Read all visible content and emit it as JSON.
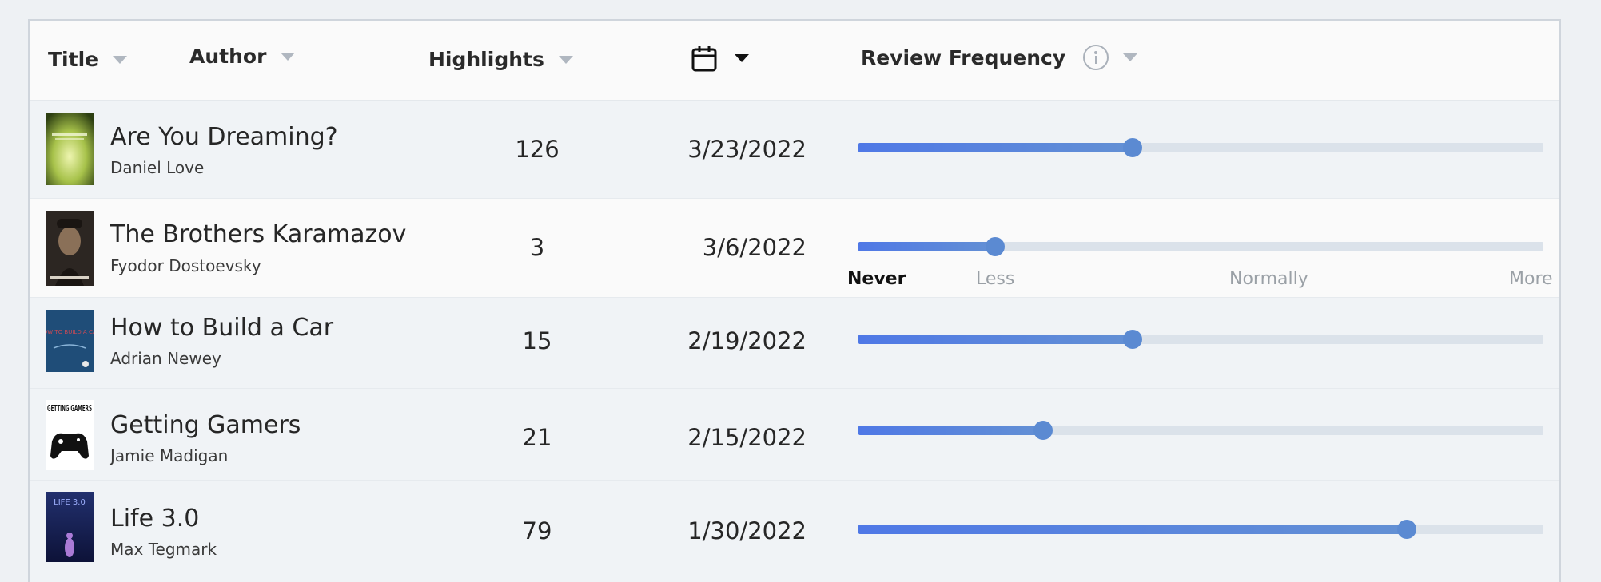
{
  "header": {
    "title_label": "Title",
    "author_label": "Author",
    "highlights_label": "Highlights",
    "review_frequency_label": "Review Frequency"
  },
  "books": [
    {
      "title": "Are You Dreaming?",
      "author": "Daniel Love",
      "highlights": "126",
      "date": "3/23/2022",
      "frequency": 0.4
    },
    {
      "title": "The Brothers Karamazov",
      "author": "Fyodor Dostoevsky",
      "highlights": "3",
      "date": "3/6/2022",
      "frequency": 0.2
    },
    {
      "title": "How to Build a Car",
      "author": "Adrian Newey",
      "highlights": "15",
      "date": "2/19/2022",
      "frequency": 0.4
    },
    {
      "title": "Getting Gamers",
      "author": "Jamie Madigan",
      "highlights": "21",
      "date": "2/15/2022",
      "frequency": 0.27
    },
    {
      "title": "Life 3.0",
      "author": "Max Tegmark",
      "highlights": "79",
      "date": "1/30/2022",
      "frequency": 0.8
    }
  ],
  "frequency_scale": {
    "never": "Never",
    "less": "Less",
    "normally": "Normally",
    "more": "More",
    "selected": "Never"
  },
  "covers": {
    "getting_gamers_text": "GETTING GAMERS",
    "life_text": "LIFE 3.0",
    "car_text": "HOW TO BUILD A CAR"
  },
  "colors": {
    "slider_fill": "#4f78e6",
    "slider_track": "#dbe2ea",
    "slider_knob": "#5b8ad2"
  }
}
